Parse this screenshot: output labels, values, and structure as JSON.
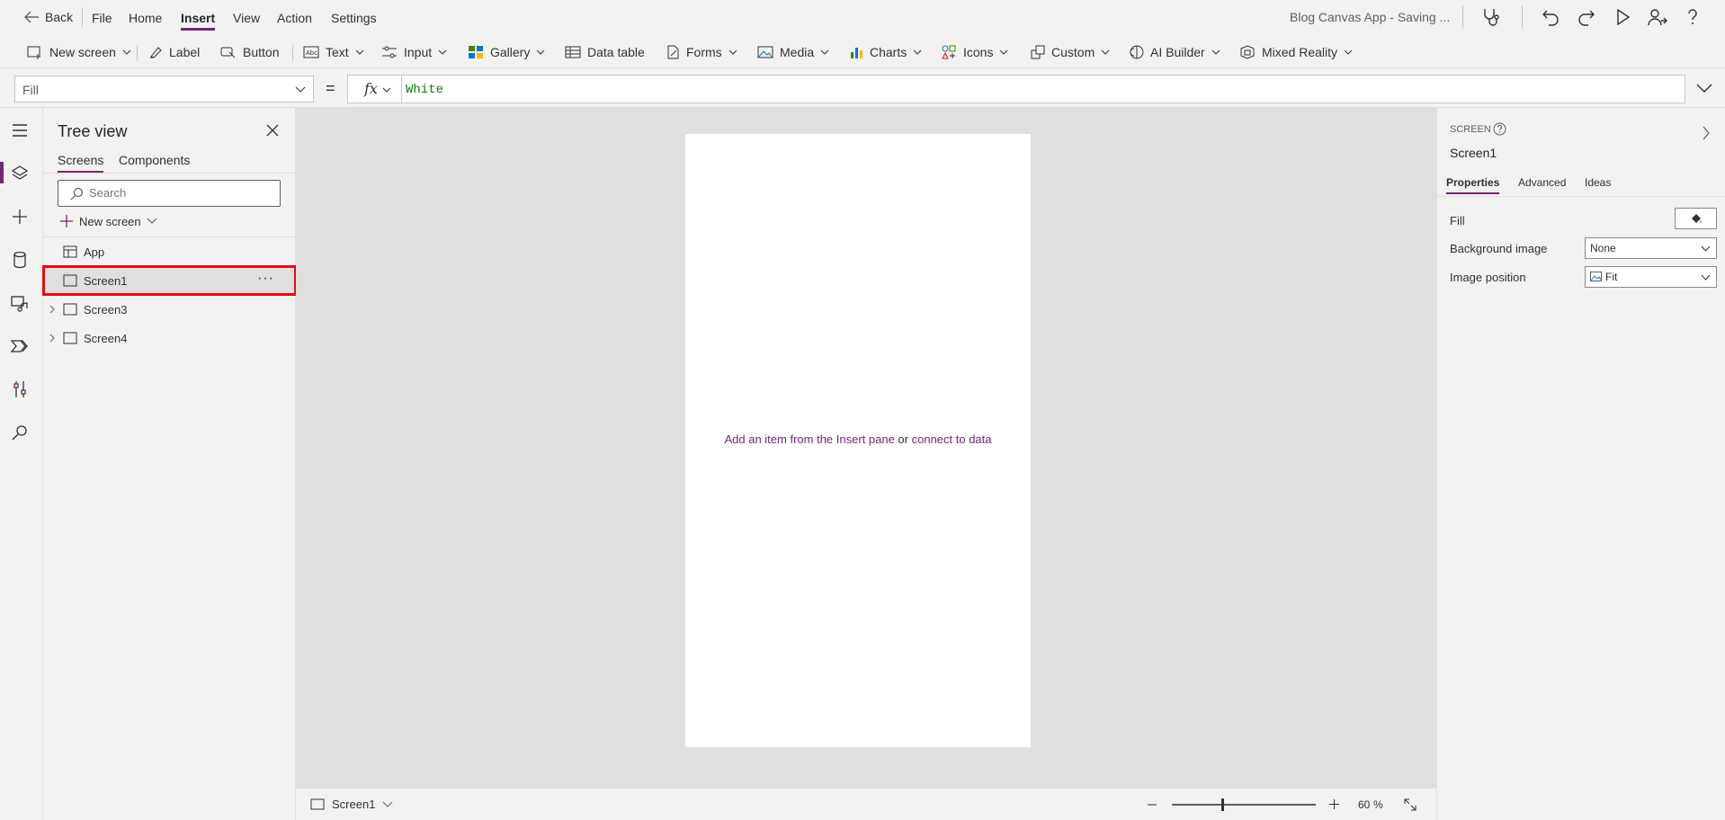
{
  "topbar": {
    "back_label": "Back",
    "menus": [
      "File",
      "Home",
      "Insert",
      "View",
      "Action",
      "Settings"
    ],
    "active_menu": "Insert",
    "app_status": "Blog Canvas App - Saving ..."
  },
  "ribbon": {
    "new_screen": "New screen",
    "label": "Label",
    "button": "Button",
    "text": "Text",
    "input": "Input",
    "gallery": "Gallery",
    "data_table": "Data table",
    "forms": "Forms",
    "media": "Media",
    "charts": "Charts",
    "icons": "Icons",
    "custom": "Custom",
    "ai_builder": "AI Builder",
    "mixed_reality": "Mixed Reality"
  },
  "formula": {
    "property": "Fill",
    "equals": "=",
    "fx": "fx",
    "value": "White"
  },
  "tree": {
    "title": "Tree view",
    "tabs": [
      "Screens",
      "Components"
    ],
    "search_placeholder": "Search",
    "new_screen": "New screen",
    "items": [
      {
        "label": "App"
      },
      {
        "label": "Screen1"
      },
      {
        "label": "Screen3"
      },
      {
        "label": "Screen4"
      }
    ],
    "more": "···"
  },
  "canvas": {
    "placeholder_prefix": "Add an item from the Insert pane",
    "placeholder_or": " or ",
    "placeholder_link": "connect to data"
  },
  "status": {
    "screen": "Screen1",
    "zoom_value": "60",
    "zoom_unit": "%",
    "zoom_fraction": 0.35
  },
  "props": {
    "type_label": "SCREEN",
    "name": "Screen1",
    "tabs": [
      "Properties",
      "Advanced",
      "Ideas"
    ],
    "fill_label": "Fill",
    "bg_label": "Background image",
    "bg_value": "None",
    "pos_label": "Image position",
    "pos_value": "Fit"
  },
  "colors": {
    "accent": "#742774",
    "selection_outline": "#e00e16",
    "formula_text": "#107c10"
  }
}
